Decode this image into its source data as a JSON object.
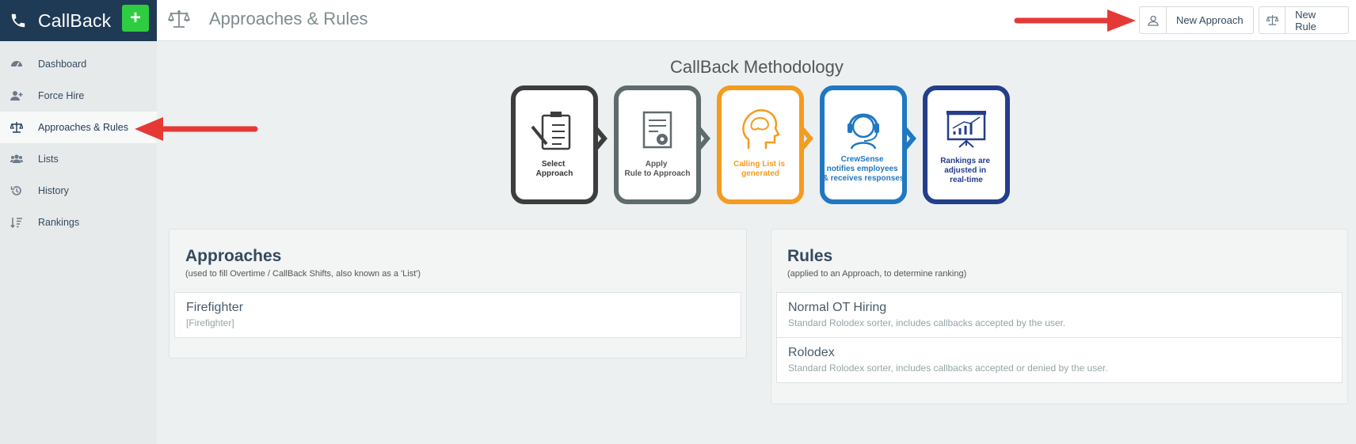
{
  "app": {
    "title": "CallBack",
    "add_label": "+"
  },
  "sidebar": {
    "items": [
      {
        "label": "Dashboard",
        "icon": "dashboard-icon"
      },
      {
        "label": "Force Hire",
        "icon": "user-plus-icon"
      },
      {
        "label": "Approaches & Rules",
        "icon": "balance-scale-icon",
        "active": true
      },
      {
        "label": "Lists",
        "icon": "users-icon"
      },
      {
        "label": "History",
        "icon": "history-icon"
      },
      {
        "label": "Rankings",
        "icon": "sort-icon"
      }
    ]
  },
  "header": {
    "title": "Approaches & Rules",
    "new_approach_label": "New Approach",
    "new_rule_label": "New Rule"
  },
  "methodology": {
    "title": "CallBack Methodology",
    "steps": [
      {
        "lines": [
          "Select",
          "Approach"
        ],
        "color": "#3d3d3d"
      },
      {
        "lines": [
          "Apply",
          "Rule to Approach"
        ],
        "color": "#5f6b6d"
      },
      {
        "lines": [
          "Calling List is",
          "generated"
        ],
        "color": "#f39c1f"
      },
      {
        "lines": [
          "CrewSense",
          "notifies employees",
          "& receives responses"
        ],
        "color": "#1f78c1"
      },
      {
        "lines": [
          "Rankings are",
          "adjusted in",
          "real-time"
        ],
        "color": "#233e8b"
      }
    ]
  },
  "approaches": {
    "title": "Approaches",
    "subtitle": "(used to fill Overtime / CallBack Shifts, also known as a 'List')",
    "items": [
      {
        "name": "Firefighter",
        "desc": "[Firefighter]"
      }
    ]
  },
  "rules": {
    "title": "Rules",
    "subtitle": "(applied to an Approach, to determine ranking)",
    "items": [
      {
        "name": "Normal OT Hiring",
        "desc": "Standard Rolodex sorter, includes callbacks accepted by the user."
      },
      {
        "name": "Rolodex",
        "desc": "Standard Rolodex sorter, includes callbacks accepted or denied by the user."
      }
    ]
  },
  "colors": {
    "brand": "#1f3a55",
    "add": "#2ecc40",
    "arrow": "#e53935"
  }
}
